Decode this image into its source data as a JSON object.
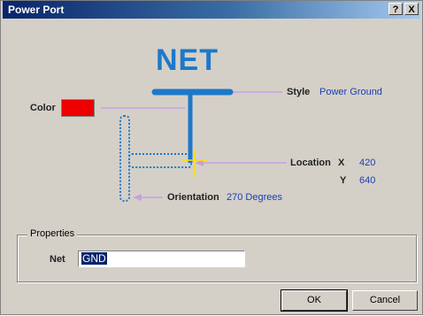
{
  "window": {
    "title": "Power Port",
    "help_glyph": "?",
    "close_glyph": "X"
  },
  "preview": {
    "net_text": "NET",
    "style_label": "Style",
    "style_value": "Power Ground",
    "color_label": "Color",
    "color_value": "#ee0000",
    "location_label": "Location",
    "x_label": "X",
    "x_value": "420",
    "y_label": "Y",
    "y_value": "640",
    "orientation_label": "Orientation",
    "orientation_value": "270 Degrees"
  },
  "properties": {
    "legend": "Properties",
    "net_label": "Net",
    "net_value": "GND"
  },
  "buttons": {
    "ok": "OK",
    "cancel": "Cancel"
  },
  "colors": {
    "symbol_blue": "#1e78c8",
    "guide_line": "#c8a0e0",
    "value_blue": "#1a3fb3",
    "highlight": "#ffe000"
  }
}
